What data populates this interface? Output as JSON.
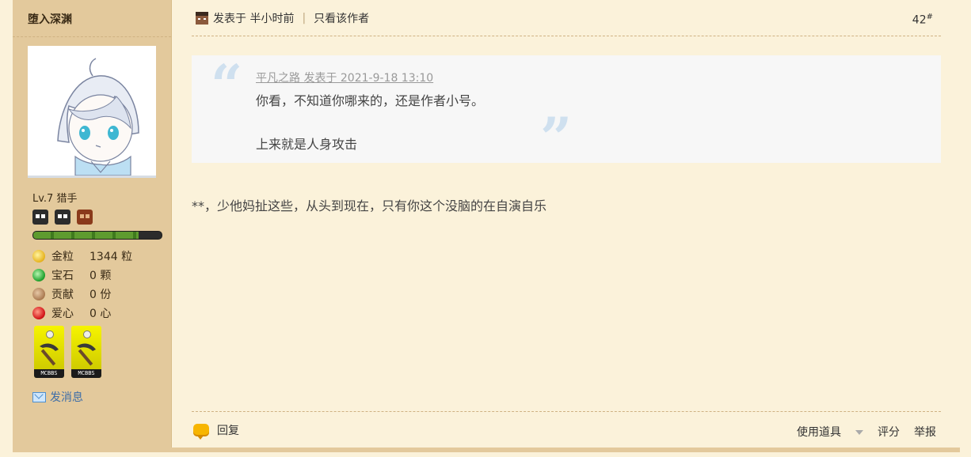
{
  "author": {
    "name": "堕入深渊",
    "level": "Lv.7 猎手",
    "stats": [
      {
        "icon": "gold-nugget-icon",
        "label": "金粒",
        "value": "1344 粒"
      },
      {
        "icon": "gem-icon",
        "label": "宝石",
        "value": "0 颗"
      },
      {
        "icon": "contribution-icon",
        "label": "贡献",
        "value": "0 份"
      },
      {
        "icon": "heart-apple-icon",
        "label": "爱心",
        "value": "0 心"
      }
    ],
    "badges": [
      "MCBBS",
      "MCBBS"
    ],
    "send_message": "发消息",
    "level_progress": 0.82
  },
  "post": {
    "posted_at": "发表于 半小时前",
    "only_author": "只看该作者",
    "floor_number": "42",
    "floor_mark": "#",
    "quote": {
      "meta": "平凡之路 发表于 2021-9-18 13:10",
      "line1": "你看，不知道你哪来的，还是作者小号。",
      "line2": "上来就是人身攻击"
    },
    "content": "**，少他妈扯这些，从头到现在，只有你这个没脑的在自演自乐",
    "footer": {
      "reply": "回复",
      "use_item": "使用道具",
      "rate": "评分",
      "report": "举报"
    }
  }
}
